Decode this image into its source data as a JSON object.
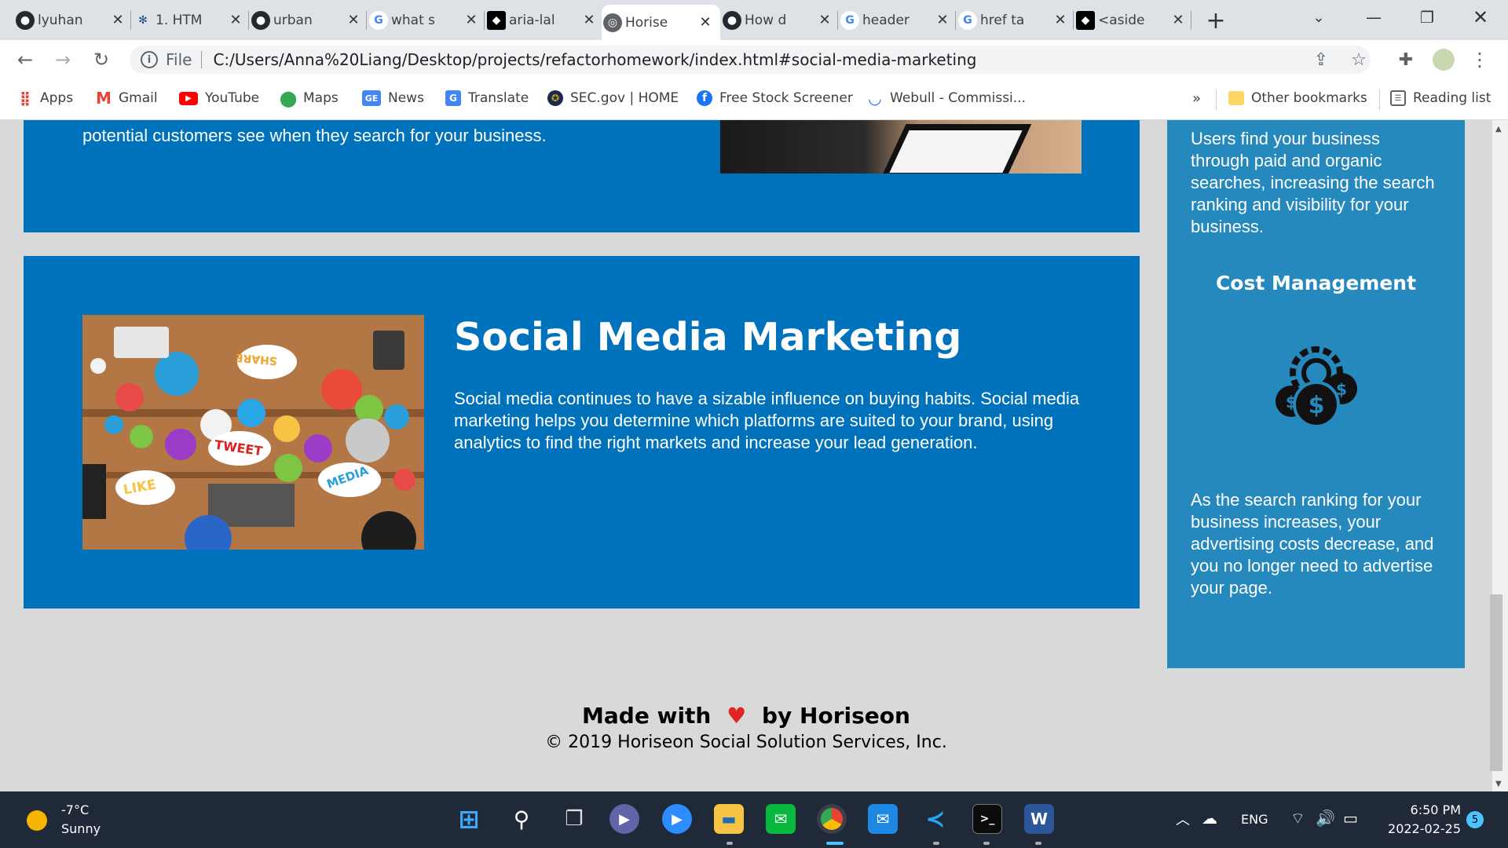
{
  "browser": {
    "tabs": [
      {
        "title": "lyuhan",
        "icon": "github-icon"
      },
      {
        "title": "1. HTM",
        "icon": "figma-icon"
      },
      {
        "title": "urban",
        "icon": "github-icon"
      },
      {
        "title": "what s",
        "icon": "google-icon"
      },
      {
        "title": "aria-lal",
        "icon": "mdn-icon"
      },
      {
        "title": "Horise",
        "icon": "globe-icon",
        "active": true
      },
      {
        "title": "How d",
        "icon": "github-icon"
      },
      {
        "title": "header",
        "icon": "google-icon"
      },
      {
        "title": "href ta",
        "icon": "google-icon"
      },
      {
        "title": "<aside",
        "icon": "mdn-icon"
      }
    ],
    "new_tab": "+",
    "url_scheme_label": "File",
    "url": "C:/Users/Anna%20Liang/Desktop/projects/refactorhomework/index.html#social-media-marketing",
    "bookmarks": [
      {
        "label": "Apps",
        "icon": "apps-grid-icon"
      },
      {
        "label": "Gmail",
        "icon": "gmail-icon"
      },
      {
        "label": "YouTube",
        "icon": "youtube-icon"
      },
      {
        "label": "Maps",
        "icon": "maps-icon"
      },
      {
        "label": "News",
        "icon": "news-icon"
      },
      {
        "label": "Translate",
        "icon": "translate-icon"
      },
      {
        "label": "SEC.gov | HOME",
        "icon": "sec-icon"
      },
      {
        "label": "Free Stock Screener",
        "icon": "facebook-icon"
      },
      {
        "label": "Webull - Commissi...",
        "icon": "webull-icon"
      }
    ],
    "overflow": "»",
    "other_bookmarks": "Other bookmarks",
    "reading_list": "Reading list"
  },
  "page": {
    "top_section_text": "potential customers see when they search for your business.",
    "social_media": {
      "title": "Social Media Marketing",
      "text": "Social media continues to have a sizable influence on buying habits. Social media marketing helps you determine which platforms are suited to your brand, using analytics to find the right markets and increase your lead generation.",
      "image_words": [
        "SHARE",
        "TWEET",
        "LIKE",
        "MEDIA"
      ]
    },
    "aside": {
      "top_text": "Users find your business through paid and organic searches, increasing the search ranking and visibility for your business.",
      "cost_title": "Cost Management",
      "cost_text": "As the search ranking for your business increases, your advertising costs decrease, and you no longer need to advertise your page."
    },
    "footer": {
      "made_with": "Made with",
      "by": "by Horiseon",
      "copyright": "© 2019 Horiseon Social Solution Services, Inc."
    }
  },
  "taskbar": {
    "weather_temp": "-7°C",
    "weather_desc": "Sunny",
    "lang": "ENG",
    "time": "6:50 PM",
    "date": "2022-02-25",
    "notifications": "5"
  },
  "colors": {
    "section_blue": "#0072bb",
    "aside_blue": "#2589bd",
    "page_bg": "#d9d9d9",
    "heart": "#e02424"
  }
}
